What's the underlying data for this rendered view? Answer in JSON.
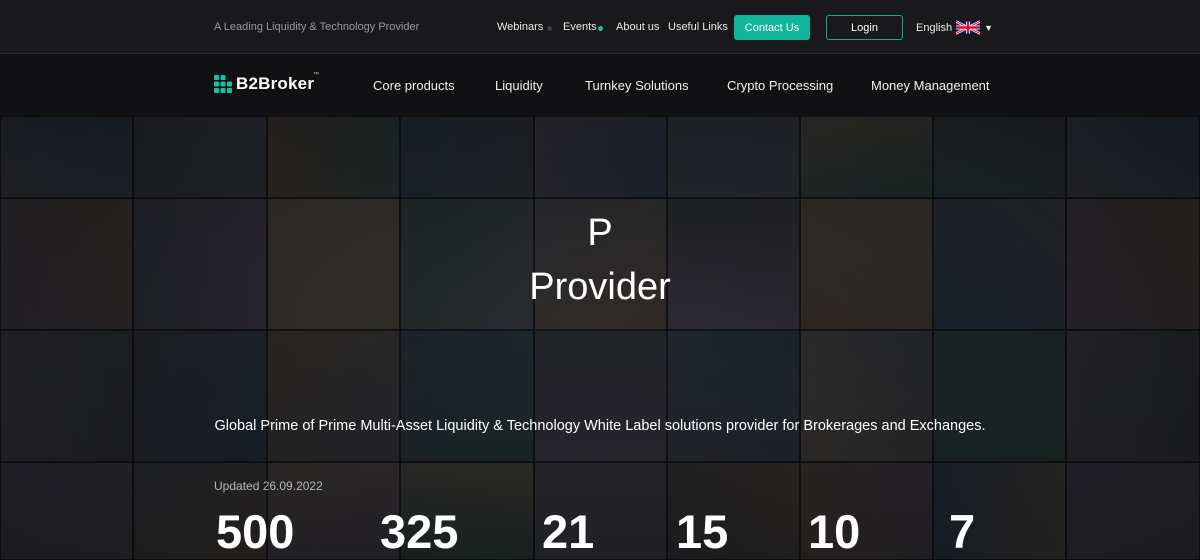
{
  "topbar": {
    "tagline": "A Leading Liquidity & Technology Provider",
    "links": [
      {
        "label": "Webinars"
      },
      {
        "label": "Events"
      },
      {
        "label": "About us"
      },
      {
        "label": "Useful Links"
      }
    ],
    "contact_label": "Contact Us",
    "login_label": "Login",
    "language": "English",
    "language_flag_icon": "uk-flag-icon",
    "accent_color": "#12b59a"
  },
  "navbar": {
    "logo_text": "B2Broker",
    "logo_tm": "™",
    "items": [
      {
        "label": "Core products"
      },
      {
        "label": "Liquidity"
      },
      {
        "label": "Turnkey Solutions"
      },
      {
        "label": "Crypto Processing"
      },
      {
        "label": "Money Management"
      }
    ]
  },
  "hero": {
    "title_line1": "P",
    "title_line2": "Provider",
    "subtitle": "Global Prime of Prime Multi-Asset Liquidity & Technology White Label solutions provider for Brokerages and Exchanges.",
    "updated": "Updated 26.09.2022",
    "stats": [
      "500",
      "325",
      "21",
      "15",
      "10",
      "7"
    ]
  }
}
